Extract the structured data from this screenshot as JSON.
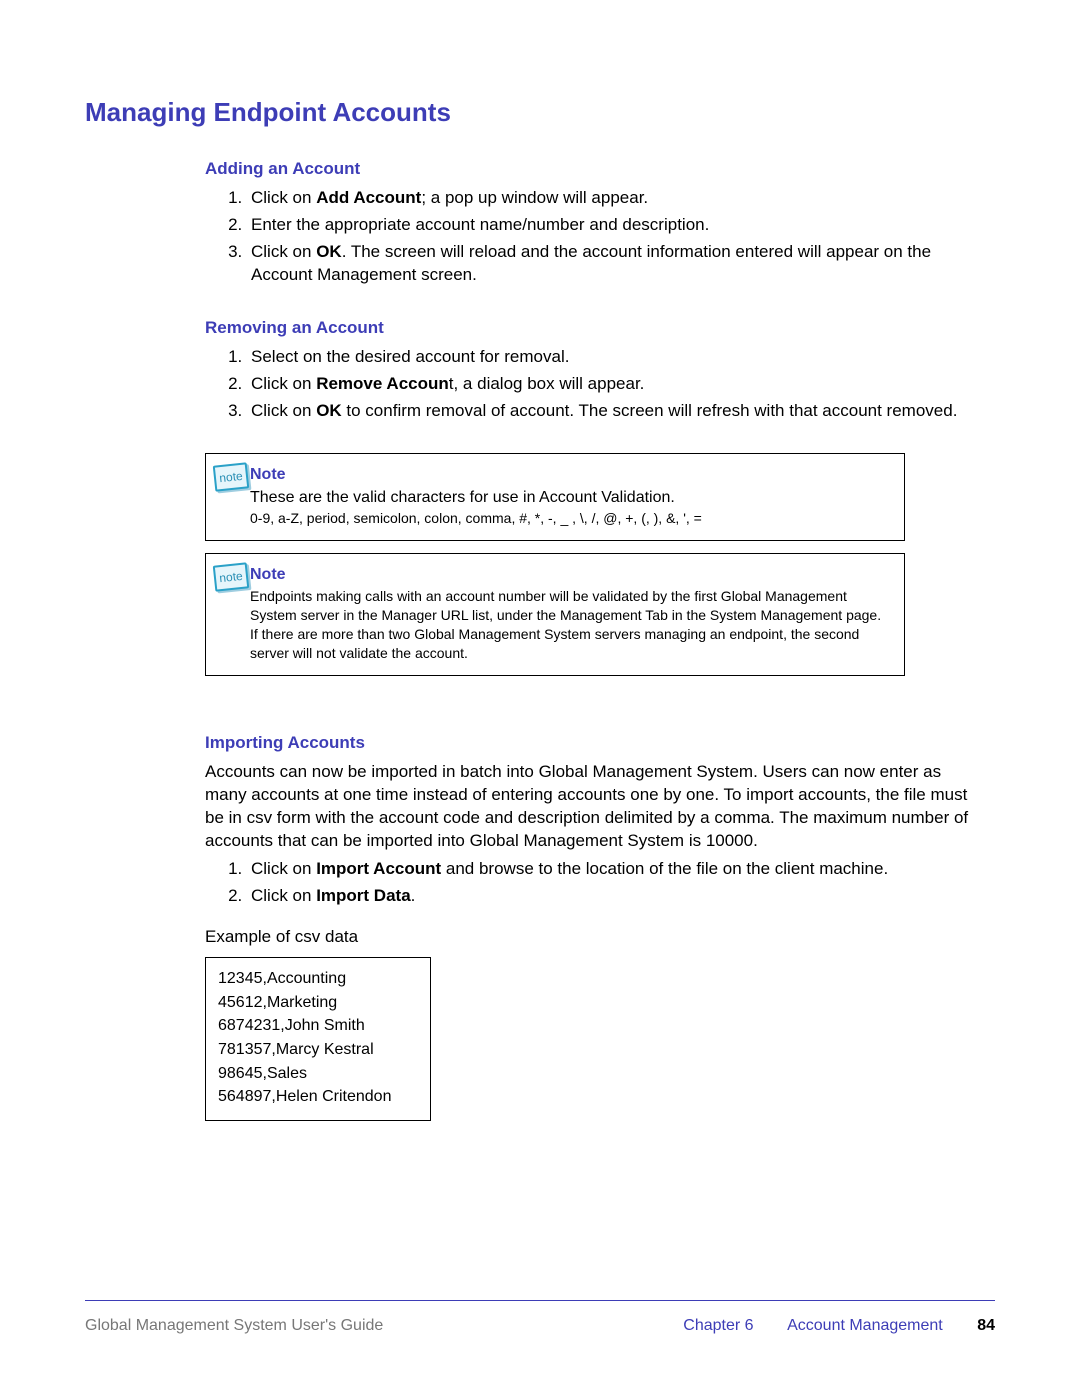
{
  "title": "Managing Endpoint Accounts",
  "sections": {
    "adding": {
      "heading": "Adding an Account",
      "steps": [
        {
          "pre": "Click on ",
          "bold": "Add Account",
          "post": "; a pop up window will appear."
        },
        {
          "pre": "Enter the appropriate account name/number and description.",
          "bold": "",
          "post": ""
        },
        {
          "pre": "Click on ",
          "bold": "OK",
          "post": ". The screen will reload and the account information entered will appear on the Account Management screen."
        }
      ]
    },
    "removing": {
      "heading": "Removing an Account",
      "steps": [
        {
          "pre": "Select on the desired account for removal.",
          "bold": "",
          "post": ""
        },
        {
          "pre": "Click on ",
          "bold": "Remove Accoun",
          "post": "t, a dialog box will appear."
        },
        {
          "pre": "Click on ",
          "bold": "OK",
          "post": " to confirm removal of account. The screen will refresh with that account removed."
        }
      ]
    },
    "importing": {
      "heading": "Importing Accounts",
      "intro": "Accounts can now be imported in batch into Global Management System. Users can now enter as many accounts at one time instead of entering accounts one by one. To import accounts, the file must be in csv form with the account code and description delimited by a comma.  The maximum number of accounts that can be imported into Global Management System is 10000.",
      "steps": [
        {
          "pre": "Click on ",
          "bold": "Import Account",
          "post": " and browse to the location of the file on the client machine."
        },
        {
          "pre": "Click on ",
          "bold": "Import Data",
          "post": "."
        }
      ],
      "example_label": "Example of csv data",
      "csv": [
        "12345,Accounting",
        "45612,Marketing",
        "6874231,John Smith",
        "781357,Marcy Kestral",
        "98645,Sales",
        "564897,Helen Critendon"
      ]
    }
  },
  "notes": {
    "icon_text": "note",
    "label": "Note",
    "note1_body": "These are the valid characters for use in Account Validation.",
    "note1_small": "0-9, a-Z, period, semicolon, colon, comma, #, *, -, _ , \\, /, @, +, (, ), &, ', =",
    "note2_body": "Endpoints making calls with an account number will be validated by the first Global Management System server in the Manager URL list, under the Management Tab in the System Management page. If there are more than two Global Management System servers managing an endpoint, the second server will not validate the account."
  },
  "footer": {
    "left": "Global Management System User's Guide",
    "chapter": "Chapter 6",
    "section": "Account Management",
    "page": "84"
  }
}
